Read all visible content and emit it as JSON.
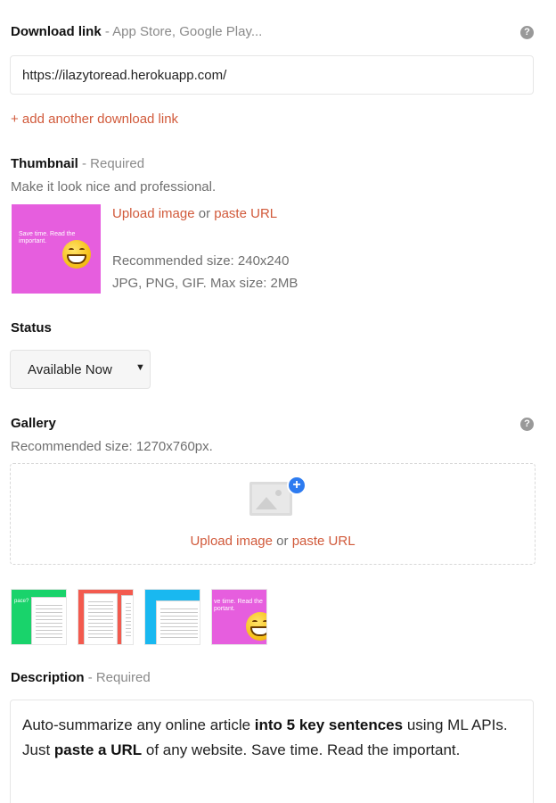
{
  "download": {
    "label": "Download link",
    "sublabel": "- App Store, Google Play...",
    "value": "https://ilazytoread.herokuapp.com/",
    "add_link": "+ add another download link",
    "help_icon": "help-icon"
  },
  "thumbnail": {
    "label": "Thumbnail",
    "sublabel": "- Required",
    "hint": "Make it look nice and professional.",
    "image_text": "Save time. Read the important.",
    "upload": "Upload image",
    "or": "or",
    "paste": "paste URL",
    "size_hint": "Recommended size: 240x240",
    "format_hint": "JPG, PNG, GIF. Max size: 2MB",
    "color": "#e65ede"
  },
  "status": {
    "label": "Status",
    "selected": "Available Now",
    "caret": "▼"
  },
  "gallery": {
    "label": "Gallery",
    "hint": "Recommended size: 1270x760px.",
    "upload": "Upload image",
    "or": "or",
    "paste": "paste URL",
    "plus": "+",
    "help_icon": "help-icon",
    "thumbnails": [
      {
        "color": "#19d36b",
        "text": "pace?"
      },
      {
        "color": "#f35a4e"
      },
      {
        "color": "#19b8f0"
      },
      {
        "color": "#e65ede",
        "text": "ve time. Read the portant."
      }
    ]
  },
  "description": {
    "label": "Description",
    "sublabel": "- Required",
    "line1_a": "Auto-summarize any online article ",
    "line1_b": "into 5 key sentences",
    "line1_c": " using ML APIs.",
    "line2_a": "Just ",
    "line2_b": "paste a URL",
    "line2_c": " of any website. Save time. Read the important."
  },
  "colors": {
    "link": "#d15a3b",
    "accent_blue": "#2d7bf0"
  }
}
